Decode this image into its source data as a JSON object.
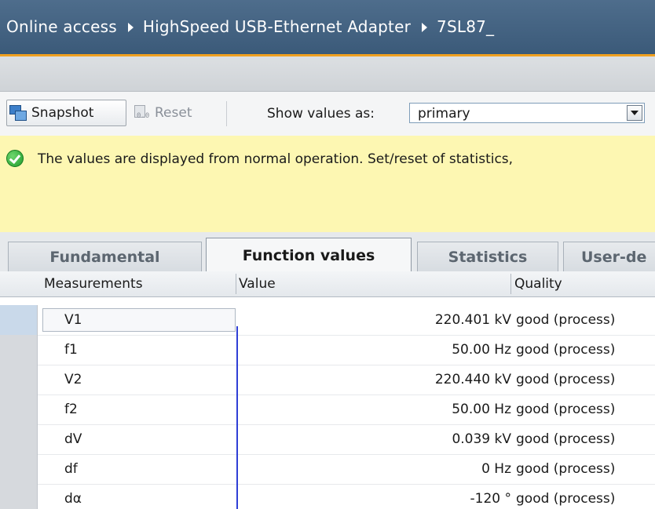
{
  "breadcrumb": {
    "items": [
      "Online access",
      "HighSpeed USB-Ethernet Adapter",
      "7SL87_"
    ]
  },
  "toolbar": {
    "snapshot_label": "Snapshot",
    "reset_label": "Reset",
    "reset_icon_digits": "0.0",
    "show_values_label": "Show values as:",
    "show_values_selected": "primary"
  },
  "banner": {
    "message": "The values are displayed from normal operation. Set/reset of statistics,",
    "status_color": "#2aa636"
  },
  "tabs": [
    {
      "label": "Fundamental",
      "active": false
    },
    {
      "label": "Function values",
      "active": true
    },
    {
      "label": "Statistics",
      "active": false
    },
    {
      "label": "User-de",
      "active": false
    }
  ],
  "table": {
    "columns": [
      "Measurements",
      "Value",
      "Quality"
    ],
    "rows": [
      {
        "measurement": "V1",
        "value": "220.401 kV",
        "quality": "good (process)"
      },
      {
        "measurement": "f1",
        "value": "50.00 Hz",
        "quality": "good (process)"
      },
      {
        "measurement": "V2",
        "value": "220.440 kV",
        "quality": "good (process)"
      },
      {
        "measurement": "f2",
        "value": "50.00 Hz",
        "quality": "good (process)"
      },
      {
        "measurement": "dV",
        "value": "0.039 kV",
        "quality": "good (process)"
      },
      {
        "measurement": "df",
        "value": "0 Hz",
        "quality": "good (process)"
      },
      {
        "measurement": "dα",
        "value": "-120 °",
        "quality": "good (process)"
      }
    ]
  },
  "colors": {
    "titlebar": "#42617f",
    "accent_line": "#f0a020",
    "banner_bg": "#fdf7b2",
    "value_column_marker": "#2f3fd6"
  }
}
